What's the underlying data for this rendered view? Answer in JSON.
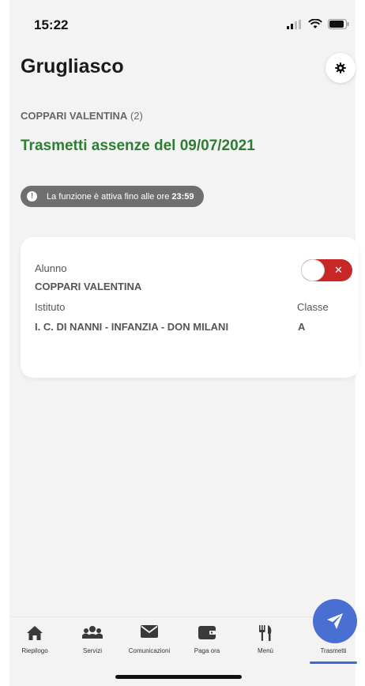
{
  "status_bar": {
    "time": "15:22"
  },
  "header": {
    "title": "Grugliasco"
  },
  "student": {
    "name": "COPPARI VALENTINA",
    "count": "(2)"
  },
  "page": {
    "subtitle": "Trasmetti assenze del 09/07/2021"
  },
  "info": {
    "text": "La funzione è attiva fino alle ore",
    "time": "23:59"
  },
  "card": {
    "alunno_label": "Alunno",
    "alunno_value": "COPPARI VALENTINA",
    "istituto_label": "Istituto",
    "istituto_value": "I. C. DI NANNI - INFANZIA - DON MILANI",
    "classe_label": "Classe",
    "classe_value": "A",
    "toggle_state": "off"
  },
  "tabs": [
    {
      "label": "Riepilogo",
      "icon": "home-icon"
    },
    {
      "label": "Servizi",
      "icon": "users-icon"
    },
    {
      "label": "Comunicazioni",
      "icon": "envelope-icon"
    },
    {
      "label": "Paga ora",
      "icon": "wallet-icon"
    },
    {
      "label": "Menù",
      "icon": "utensils-icon"
    },
    {
      "label": "Trasmetti",
      "icon": "paper-plane-icon",
      "active": true
    }
  ],
  "colors": {
    "accent": "#4a6fd2",
    "title_green": "#2e7d32",
    "toggle_red": "#c62828"
  }
}
